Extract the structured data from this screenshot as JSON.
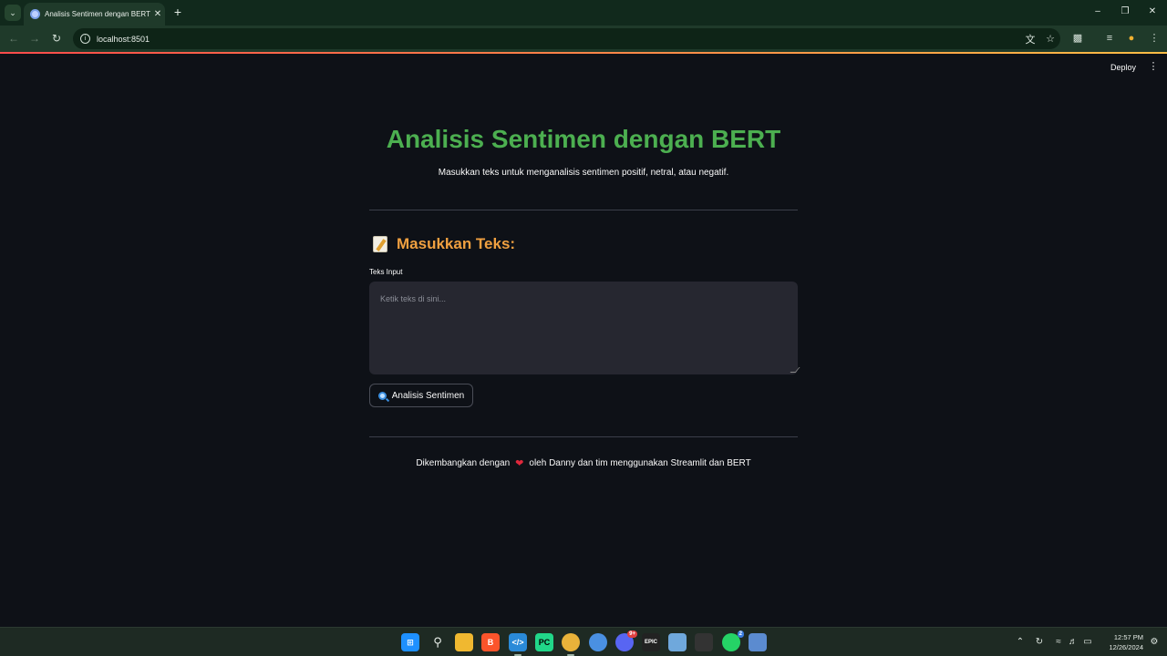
{
  "browser": {
    "tab_title": "Analisis Sentimen dengan BERT",
    "url": "localhost:8501"
  },
  "app_header": {
    "deploy_label": "Deploy"
  },
  "main": {
    "title": "Analisis Sentimen dengan BERT",
    "subtitle": "Masukkan teks untuk menganalisis sentimen positif, netral, atau negatif.",
    "section_title": "Masukkan Teks:",
    "input_label": "Teks Input",
    "input_placeholder": "Ketik teks di sini...",
    "input_value": "",
    "button_label": "Analisis Sentimen",
    "footer_prefix": "Dikembangkan dengan",
    "footer_suffix": "oleh Danny dan tim menggunakan Streamlit dan BERT"
  },
  "taskbar": {
    "time": "12:57 PM",
    "date": "12/26/2024",
    "discord_badge": "9+",
    "whatsapp_badge": "2"
  },
  "colors": {
    "title_green": "#4caf50",
    "section_orange": "#f0a040",
    "background": "#0e1117",
    "input_bg": "#262730"
  }
}
